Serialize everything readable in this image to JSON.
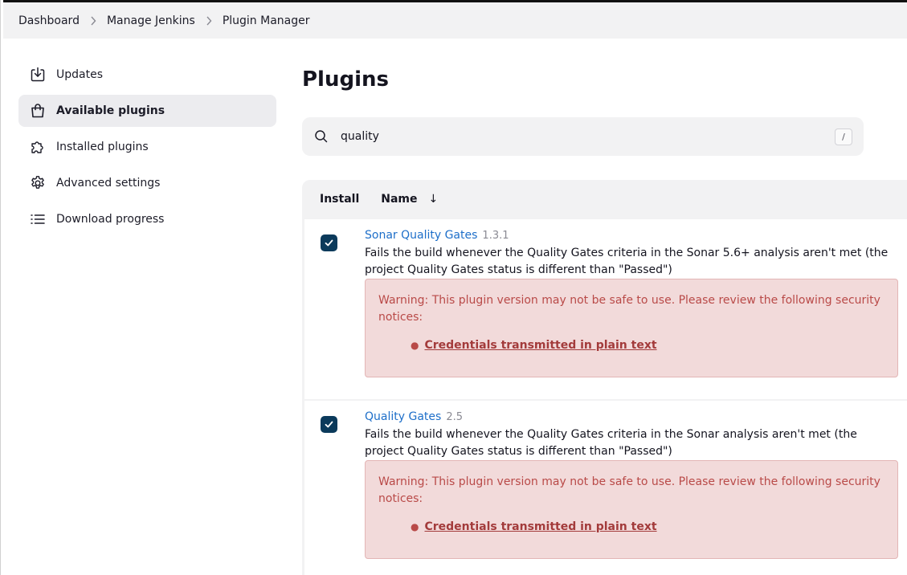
{
  "breadcrumb": {
    "items": [
      "Dashboard",
      "Manage Jenkins",
      "Plugin Manager"
    ]
  },
  "sidebar": {
    "items": [
      {
        "label": "Updates",
        "icon": "download-icon",
        "active": false
      },
      {
        "label": "Available plugins",
        "icon": "shopping-bag-icon",
        "active": true
      },
      {
        "label": "Installed plugins",
        "icon": "puzzle-icon",
        "active": false
      },
      {
        "label": "Advanced settings",
        "icon": "gear-icon",
        "active": false
      },
      {
        "label": "Download progress",
        "icon": "list-icon",
        "active": false
      }
    ]
  },
  "main": {
    "title": "Plugins",
    "search": {
      "value": "quality",
      "shortcut": "/"
    },
    "table": {
      "headers": {
        "install": "Install",
        "name": "Name",
        "sort_indicator": "↓"
      },
      "rows": [
        {
          "checked": true,
          "name": "Sonar Quality Gates",
          "version": "1.3.1",
          "description": "Fails the build whenever the Quality Gates criteria in the Sonar 5.6+ analysis aren't met (the project Quality Gates status is different than \"Passed\")",
          "warning": "Warning: This plugin version may not be safe to use. Please review the following security notices:",
          "notice": "Credentials transmitted in plain text"
        },
        {
          "checked": true,
          "name": "Quality Gates",
          "version": "2.5",
          "description": "Fails the build whenever the Quality Gates criteria in the Sonar analysis aren't met (the project Quality Gates status is different than \"Passed\")",
          "warning": "Warning: This plugin version may not be safe to use. Please review the following security notices:",
          "notice": "Credentials transmitted in plain text"
        }
      ]
    }
  },
  "colors": {
    "link": "#1e6fc9",
    "checkbox": "#0b3a5b",
    "warning_bg": "#f2dada",
    "warning_text": "#b94a48"
  }
}
